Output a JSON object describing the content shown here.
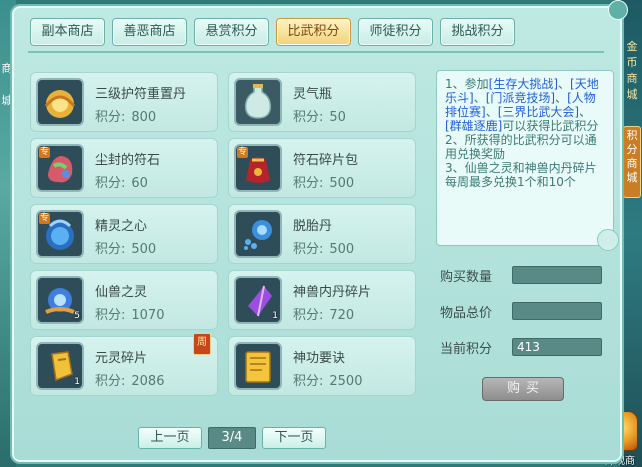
{
  "tabs": [
    {
      "label": "副本商店",
      "active": false
    },
    {
      "label": "善恶商店",
      "active": false
    },
    {
      "label": "悬赏积分",
      "active": false
    },
    {
      "label": "比武积分",
      "active": true
    },
    {
      "label": "师徒积分",
      "active": false
    },
    {
      "label": "挑战积分",
      "active": false
    }
  ],
  "items": [
    {
      "name": "三级护符重置丹",
      "price_label": "积分:",
      "price": "800",
      "icon": "gold-lotus-pill-icon",
      "badge": "",
      "qty": ""
    },
    {
      "name": "灵气瓶",
      "price_label": "积分:",
      "price": "50",
      "icon": "spirit-vase-icon",
      "badge": "",
      "qty": ""
    },
    {
      "name": "尘封的符石",
      "price_label": "积分:",
      "price": "60",
      "icon": "dusty-rune-stone-icon",
      "badge": "专",
      "qty": ""
    },
    {
      "name": "符石碎片包",
      "price_label": "积分:",
      "price": "500",
      "icon": "rune-shard-bag-icon",
      "badge": "专",
      "qty": ""
    },
    {
      "name": "精灵之心",
      "price_label": "积分:",
      "price": "500",
      "icon": "spirit-heart-icon",
      "badge": "专",
      "qty": ""
    },
    {
      "name": "脱胎丹",
      "price_label": "积分:",
      "price": "500",
      "icon": "rebirth-pill-icon",
      "badge": "",
      "qty": ""
    },
    {
      "name": "仙兽之灵",
      "price_label": "积分:",
      "price": "1070",
      "icon": "beast-spirit-icon",
      "badge": "",
      "qty": "5"
    },
    {
      "name": "神兽内丹碎片",
      "price_label": "积分:",
      "price": "720",
      "icon": "purple-crystal-shard-icon",
      "badge": "",
      "qty": "1"
    },
    {
      "name": "元灵碎片",
      "price_label": "积分:",
      "price": "2086",
      "icon": "yuanling-shard-icon",
      "badge": "",
      "qty": "1",
      "weekly": "周"
    },
    {
      "name": "神功要诀",
      "price_label": "积分:",
      "price": "2500",
      "icon": "secret-book-icon",
      "badge": "",
      "qty": ""
    }
  ],
  "info": {
    "p1_a": "1、参加",
    "p1_l1": "[生存大挑战]",
    "p1_s1": "、",
    "p1_l2": "[天地乐斗]",
    "p1_s2": "、",
    "p1_l3": "[门派竞技场]",
    "p1_s3": "、",
    "p1_l4": "[人物排位赛]",
    "p1_s4": "、",
    "p1_l5": "[三界比武大会]",
    "p1_s5": "、",
    "p1_l6": "[群雄逐鹿]",
    "p1_b": "可以获得比武积分",
    "p2": "2、所获得的比武积分可以通用兑换奖励",
    "p3": "3、仙兽之灵和神兽内丹碎片每周最多兑换1个和10个"
  },
  "form": {
    "qty_label": "购买数量",
    "qty_value": "",
    "total_label": "物品总价",
    "total_value": "",
    "current_label": "当前积分",
    "current_value": "413",
    "buy_label": "购买"
  },
  "pager": {
    "prev": "上一页",
    "page": "3/4",
    "next": "下一页"
  },
  "side": {
    "left_1": "商",
    "left_2": "城",
    "right_1": "金",
    "right_2": "币",
    "right_3": "商",
    "right_4": "城",
    "right_5": "积分商城",
    "welcome": "外观商"
  }
}
